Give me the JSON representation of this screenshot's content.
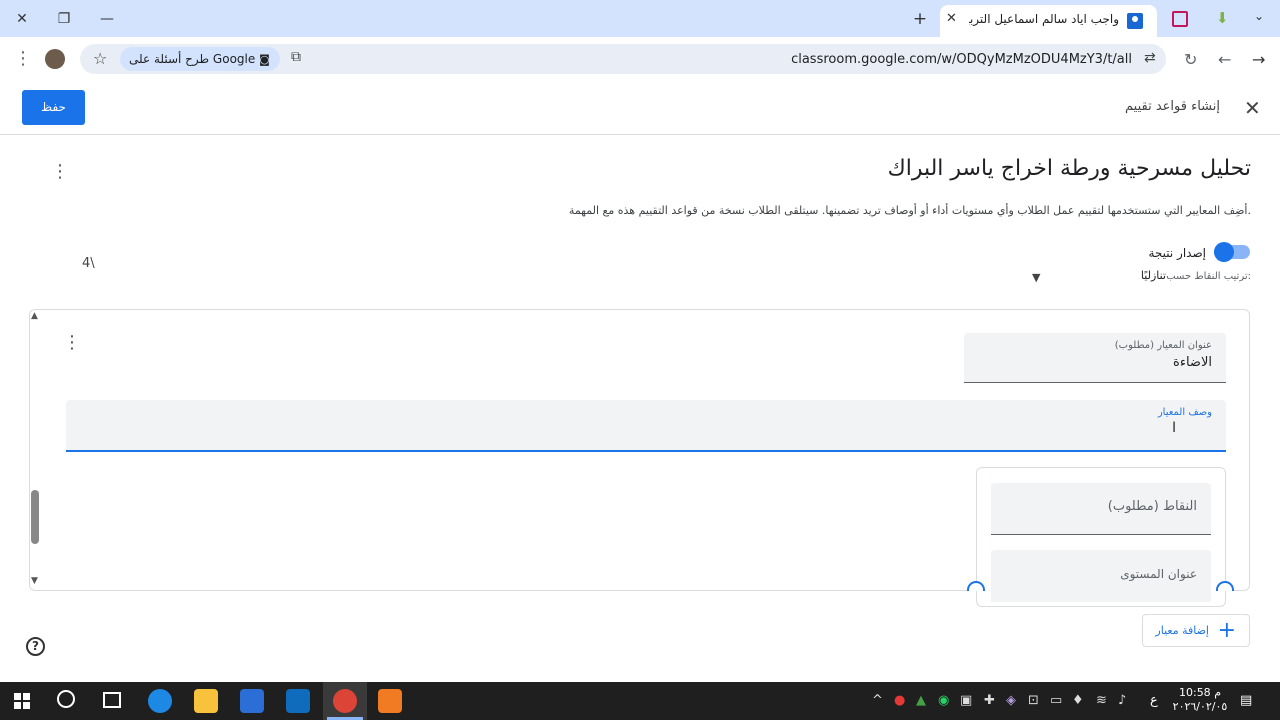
{
  "browser": {
    "tab_title": "واجب اياد سالم اسماعيل التربية ال...",
    "url": "classroom.google.com/w/ODQyMzMzODU4MzY3/t/all",
    "google_chip": "طرح أسئلة على Google",
    "new_tab": "+",
    "close_tab": "✕",
    "icons": [
      "minimize-icon",
      "restore-icon",
      "close-icon",
      "reload-icon",
      "back-icon",
      "forward-icon",
      "star-icon",
      "menu-icon"
    ]
  },
  "header": {
    "title": "إنشاء قواعد تقييم",
    "save_label": "حفظ",
    "close_label": "✕"
  },
  "rubric": {
    "title": "تحليل مسرحية ورطة اخراج ياسر البراك",
    "description": "أضِف المعايير التي ستستخدمها لتقييم عمل الطلاب وأي مستويات أداء أو أوصاف تريد تضمينها. سيتلقى الطلاب نسخة من قواعد التقييم هذه مع المهمة.",
    "score_toggle_label": "إصدار نتيجة",
    "score_toggle_on": true,
    "sort_label": "ترتيب النقاط حسب:",
    "sort_value": "تنازليًا",
    "total_score": "4\\"
  },
  "criterion": {
    "title_label": "عنوان المعيار (مطلوب)",
    "title_value": "الاضاءة",
    "description_label": "وصف المعيار",
    "points_placeholder": "النقاط (مطلوب)",
    "level_title_placeholder": "عنوان المستوى"
  },
  "actions": {
    "add_criterion": "إضافة معيار",
    "help": "?"
  },
  "taskbar": {
    "time": "10:58 م",
    "date": "٢٠٢٦/٠٢/٠٥",
    "lang": "ع"
  },
  "colors": {
    "accent": "#1a73e8",
    "tab_bar": "#d3e3fd",
    "taskbar": "#1f1f1f"
  }
}
